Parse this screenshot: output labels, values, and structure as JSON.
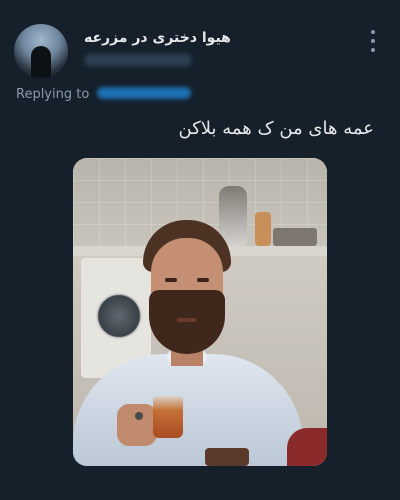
{
  "tweet": {
    "author_name": "هیوا دختری در مزرعه",
    "replying_label": "Replying to",
    "text": "عمه های من ک همه بلاکن",
    "more_icon": "more-vertical-icon"
  },
  "colors": {
    "background": "#15202b",
    "primary_text": "#e7e9ea",
    "secondary_text": "#8b98a5",
    "link_blue": "#1d9bf0"
  }
}
